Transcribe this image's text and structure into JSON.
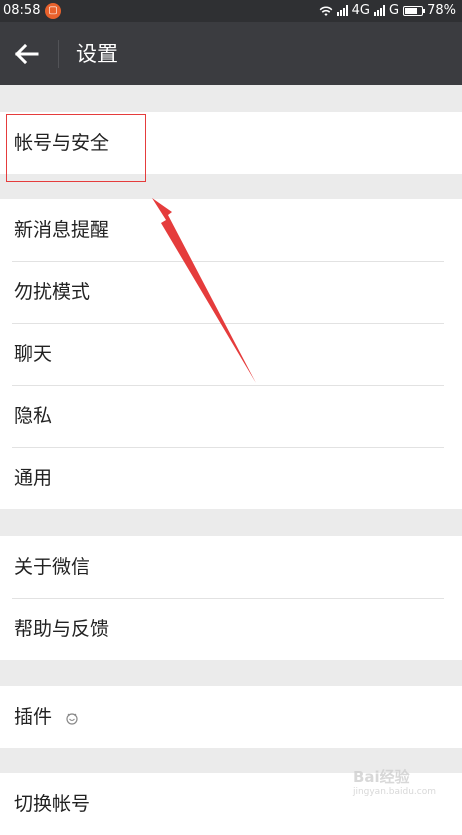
{
  "status_bar": {
    "time": "08:58",
    "notif_glyph": "▢",
    "network": "4G",
    "carrier_g": "G",
    "battery": "78%",
    "battery_level": 0.78
  },
  "app_bar": {
    "back_icon": "arrow-left-icon",
    "title": "设置"
  },
  "groups": [
    {
      "items": [
        "帐号与安全"
      ]
    },
    {
      "items": [
        "新消息提醒",
        "勿扰模式",
        "聊天",
        "隐私",
        "通用"
      ]
    },
    {
      "items": [
        "关于微信",
        "帮助与反馈"
      ]
    },
    {
      "items": [
        "插件"
      ],
      "plugin_icon": "puzzle-smile-icon"
    },
    {
      "items": [
        "切换帐号"
      ]
    }
  ],
  "annotation": {
    "box_color": "#e53c3c",
    "arrow_color": "#e53c3c"
  },
  "watermark": {
    "brand": "Bai经验",
    "url": "jingyan.baidu.com"
  }
}
